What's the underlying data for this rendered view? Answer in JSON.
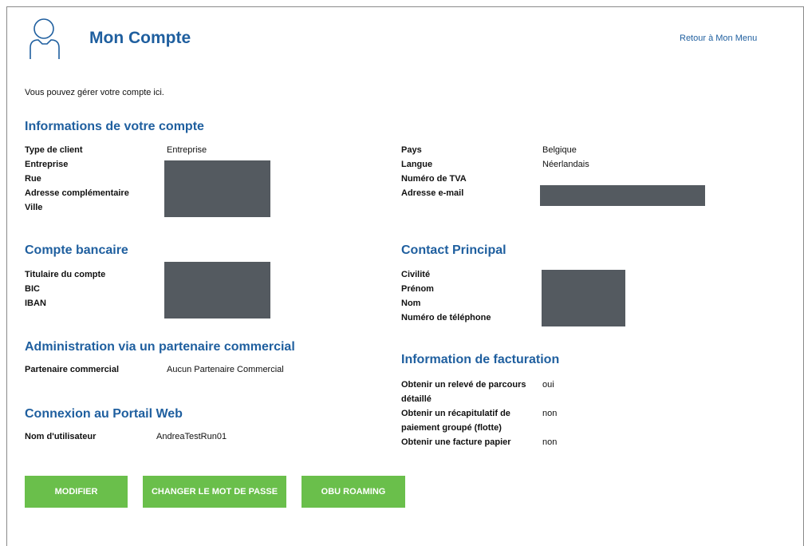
{
  "header": {
    "title": "Mon Compte",
    "back_link": "Retour à Mon Menu",
    "icon": "user-icon"
  },
  "intro": "Vous pouvez gérer votre compte ici.",
  "account_info": {
    "heading": "Informations de votre compte",
    "left": {
      "labels": [
        "Type de client",
        "Entreprise",
        "Rue",
        "Adresse complémentaire",
        "Ville"
      ],
      "client_type": "Entreprise"
    },
    "right": {
      "labels": [
        "Pays",
        "Langue",
        "Numéro de TVA",
        "Adresse e-mail"
      ],
      "country": "Belgique",
      "language": "Néerlandais"
    }
  },
  "bank_account": {
    "heading": "Compte bancaire",
    "labels": [
      "Titulaire du compte",
      "BIC",
      "IBAN"
    ]
  },
  "main_contact": {
    "heading": "Contact Principal",
    "labels": [
      "Civilité",
      "Prénom",
      "Nom",
      "Numéro de téléphone"
    ]
  },
  "partner_admin": {
    "heading": "Administration via un partenaire commercial",
    "label": "Partenaire commercial",
    "value": "Aucun Partenaire Commercial"
  },
  "billing": {
    "heading": "Information de facturation",
    "rows": [
      {
        "label": "Obtenir un relevé de parcours détaillé",
        "value": "oui"
      },
      {
        "label": "Obtenir un récapitulatif de paiement groupé (flotte)",
        "value": "non"
      },
      {
        "label": "Obtenir une facture papier",
        "value": "non"
      }
    ]
  },
  "web_portal": {
    "heading": "Connexion au Portail Web",
    "label": "Nom d'utilisateur",
    "value": "AndreaTestRun01"
  },
  "buttons": {
    "modify": "MODIFIER",
    "change_password": "CHANGER LE MOT DE PASSE",
    "obu_roaming": "OBU ROAMING"
  },
  "colors": {
    "heading": "#1f5f9f",
    "button": "#6abf4b",
    "redaction": "#545a60"
  }
}
